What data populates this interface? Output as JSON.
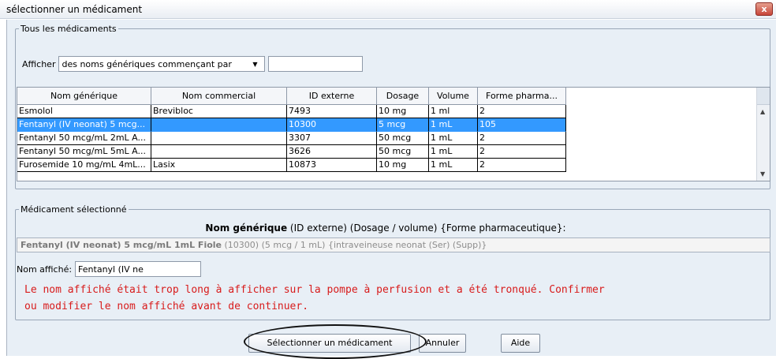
{
  "window": {
    "title": "sélectionner un médicament",
    "close_label": "x"
  },
  "all_drugs": {
    "legend": "Tous les médicaments",
    "afficher_label": "Afficher",
    "filter_select_value": "des noms génériques commençant par",
    "filter_input_value": ""
  },
  "table": {
    "columns": [
      "Nom générique",
      "Nom commercial",
      "ID externe",
      "Dosage",
      "Volume",
      "Forme pharma..."
    ],
    "rows": [
      [
        "Esmolol",
        "Brevibloc",
        "7493",
        "10 mg",
        "1 ml",
        "2"
      ],
      [
        "Fentanyl (IV neonat) 5 mcg...",
        "",
        "10300",
        "5 mcg",
        "1 mL",
        "105"
      ],
      [
        "Fentanyl 50 mcg/mL  2mL A...",
        "",
        "3307",
        "50 mcg",
        "1 mL",
        "2"
      ],
      [
        "Fentanyl 50 mcg/mL  5mL A...",
        "",
        "3626",
        "50 mcg",
        "1 mL",
        "2"
      ],
      [
        "Furosemide 10 mg/mL  4mL...",
        "Lasix",
        "10873",
        "10 mg",
        "1 mL",
        "2"
      ]
    ],
    "selected_row": 1
  },
  "selected": {
    "legend": "Médicament sélectionné",
    "heading_bold": "Nom générique",
    "heading_rest": " (ID externe) (Dosage / volume) {Forme pharmaceutique}:",
    "full_name_bold": "Fentanyl (IV neonat) 5 mcg/mL 1mL Fiole",
    "full_name_rest": " (10300) (5 mcg / 1 mL) {intraveineuse neonat (Ser) (Supp)}",
    "display_label": "Nom affiché:",
    "display_value": "Fentanyl (IV ne",
    "warning_line1": "Le nom affiché était trop long à afficher sur la pompe à perfusion et a été tronqué. Confirmer",
    "warning_line2": "ou modifier le nom affiché avant de continuer."
  },
  "buttons": {
    "select_label": "Sélectionner un médicament",
    "cancel_label": "Annuler",
    "help_label": "Aide"
  },
  "colors": {
    "selection": "#3399ff",
    "warning_text": "#d81b1b",
    "panel_bg": "#e8eff6"
  }
}
